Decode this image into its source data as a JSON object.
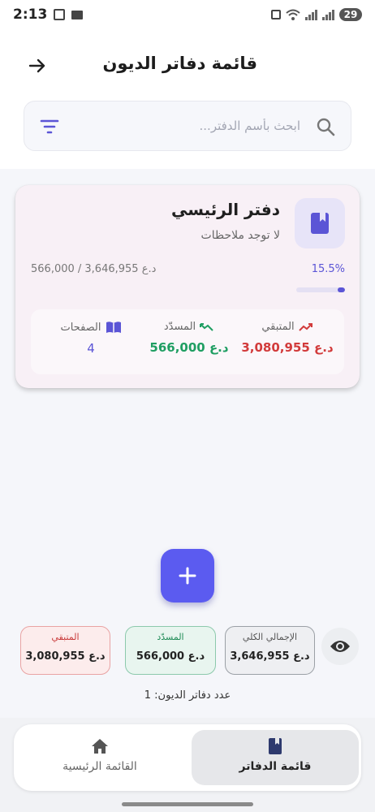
{
  "status_bar": {
    "time": "2:13",
    "battery": "29"
  },
  "header": {
    "title": "قائمة دفاتر الديون"
  },
  "search": {
    "placeholder": "ابحث بأسم الدفتر..."
  },
  "notebook_card": {
    "title": "دفتر الرئيسي",
    "notes": "لا توجد ملاحظات",
    "progress_text": "566,000 / 3,646,955 د.ع",
    "progress_percent_label": "15.5%",
    "progress_fraction": 0.155,
    "stats": {
      "remaining_label": "المتبقي",
      "remaining_value": "3,080,955 د.ع",
      "paid_label": "المسدّد",
      "paid_value": "566,000 د.ع",
      "pages_label": "الصفحات",
      "pages_value": "4"
    }
  },
  "summary": {
    "total_label": "الإجمالي الكلي",
    "total_value": "3,646,955 د.ع",
    "paid_label": "المسدّد",
    "paid_value": "566,000 د.ع",
    "remaining_label": "المتبقي",
    "remaining_value": "3,080,955 د.ع"
  },
  "count_text": "عدد دفاتر الديون: 1",
  "bottom_nav": {
    "notebooks_label": "قائمة الدفاتر",
    "home_label": "القائمة الرئيسية"
  },
  "colors": {
    "accent": "#5b5bf0",
    "paid_green": "#1f9e62",
    "remaining_red": "#d23b3b"
  },
  "icons": [
    "mail-icon",
    "wifi-icon",
    "arrow-right-icon",
    "search-icon",
    "filter-icon",
    "book-icon",
    "trend-down-icon",
    "trend-up-icon",
    "open-book-icon",
    "plus-icon",
    "eye-icon",
    "home-icon"
  ]
}
